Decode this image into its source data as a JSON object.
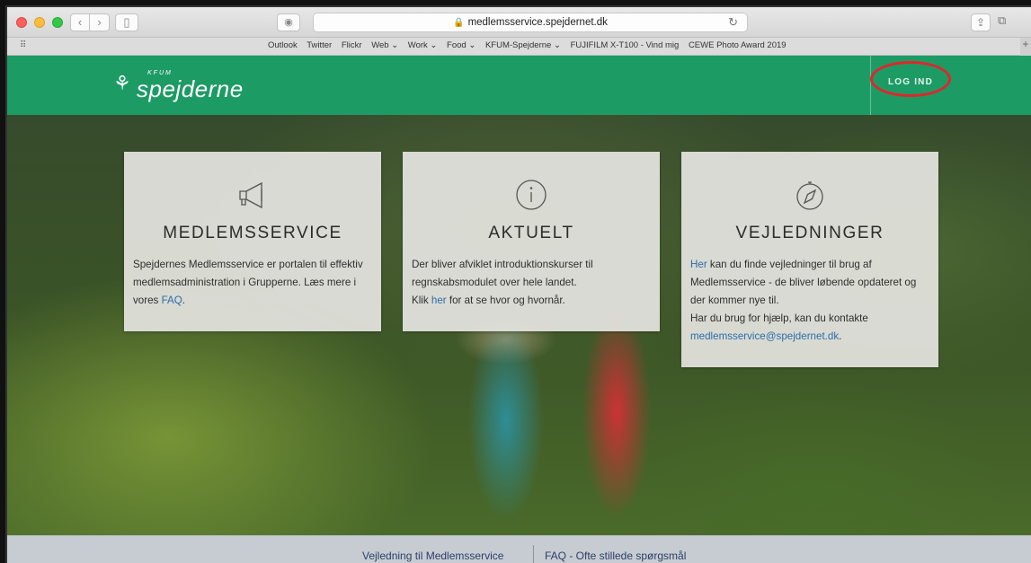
{
  "browser": {
    "url": "medlemsservice.spejdernet.dk",
    "bookmarks": [
      "Outlook",
      "Twitter",
      "Flickr",
      "Web ⌄",
      "Work ⌄",
      "Food ⌄",
      "KFUM-Spejderne ⌄",
      "FUJIFILM X-T100 - Vind mig",
      "CEWE Photo Award 2019"
    ]
  },
  "header": {
    "logo_small": "KFUM",
    "logo_text": "spejderne",
    "login_label": "LOG IND"
  },
  "cards": [
    {
      "title": "MEDLEMSSERVICE",
      "text_before": "Spejdernes Medlemsservice er portalen til effektiv medlemsadministration i Grupperne. Læs mere i vores ",
      "link": "FAQ",
      "text_after": "."
    },
    {
      "title": "AKTUELT",
      "line1": "Der bliver afviklet introduktionskurser til regnskabsmodulet over hele landet.",
      "line2_before": "Klik ",
      "link": "her",
      "line2_after": " for at se hvor og hvornår."
    },
    {
      "title": "VEJLEDNINGER",
      "link1": "Her",
      "text1": " kan du finde vejledninger til brug af Medlemsservice - de bliver løbende opdateret og der kommer nye til.",
      "text2": "Har du brug for hjælp, kan du kontakte ",
      "email": "medlemsservice@spejdernet.dk",
      "text3": "."
    }
  ],
  "footer": {
    "link1": "Vejledning til Medlemsservice",
    "link2": "FAQ - Ofte stillede spørgsmål"
  },
  "colors": {
    "brand_green": "#1d9b65",
    "link_blue": "#2d6ca8",
    "highlight_red": "#e0262c"
  }
}
